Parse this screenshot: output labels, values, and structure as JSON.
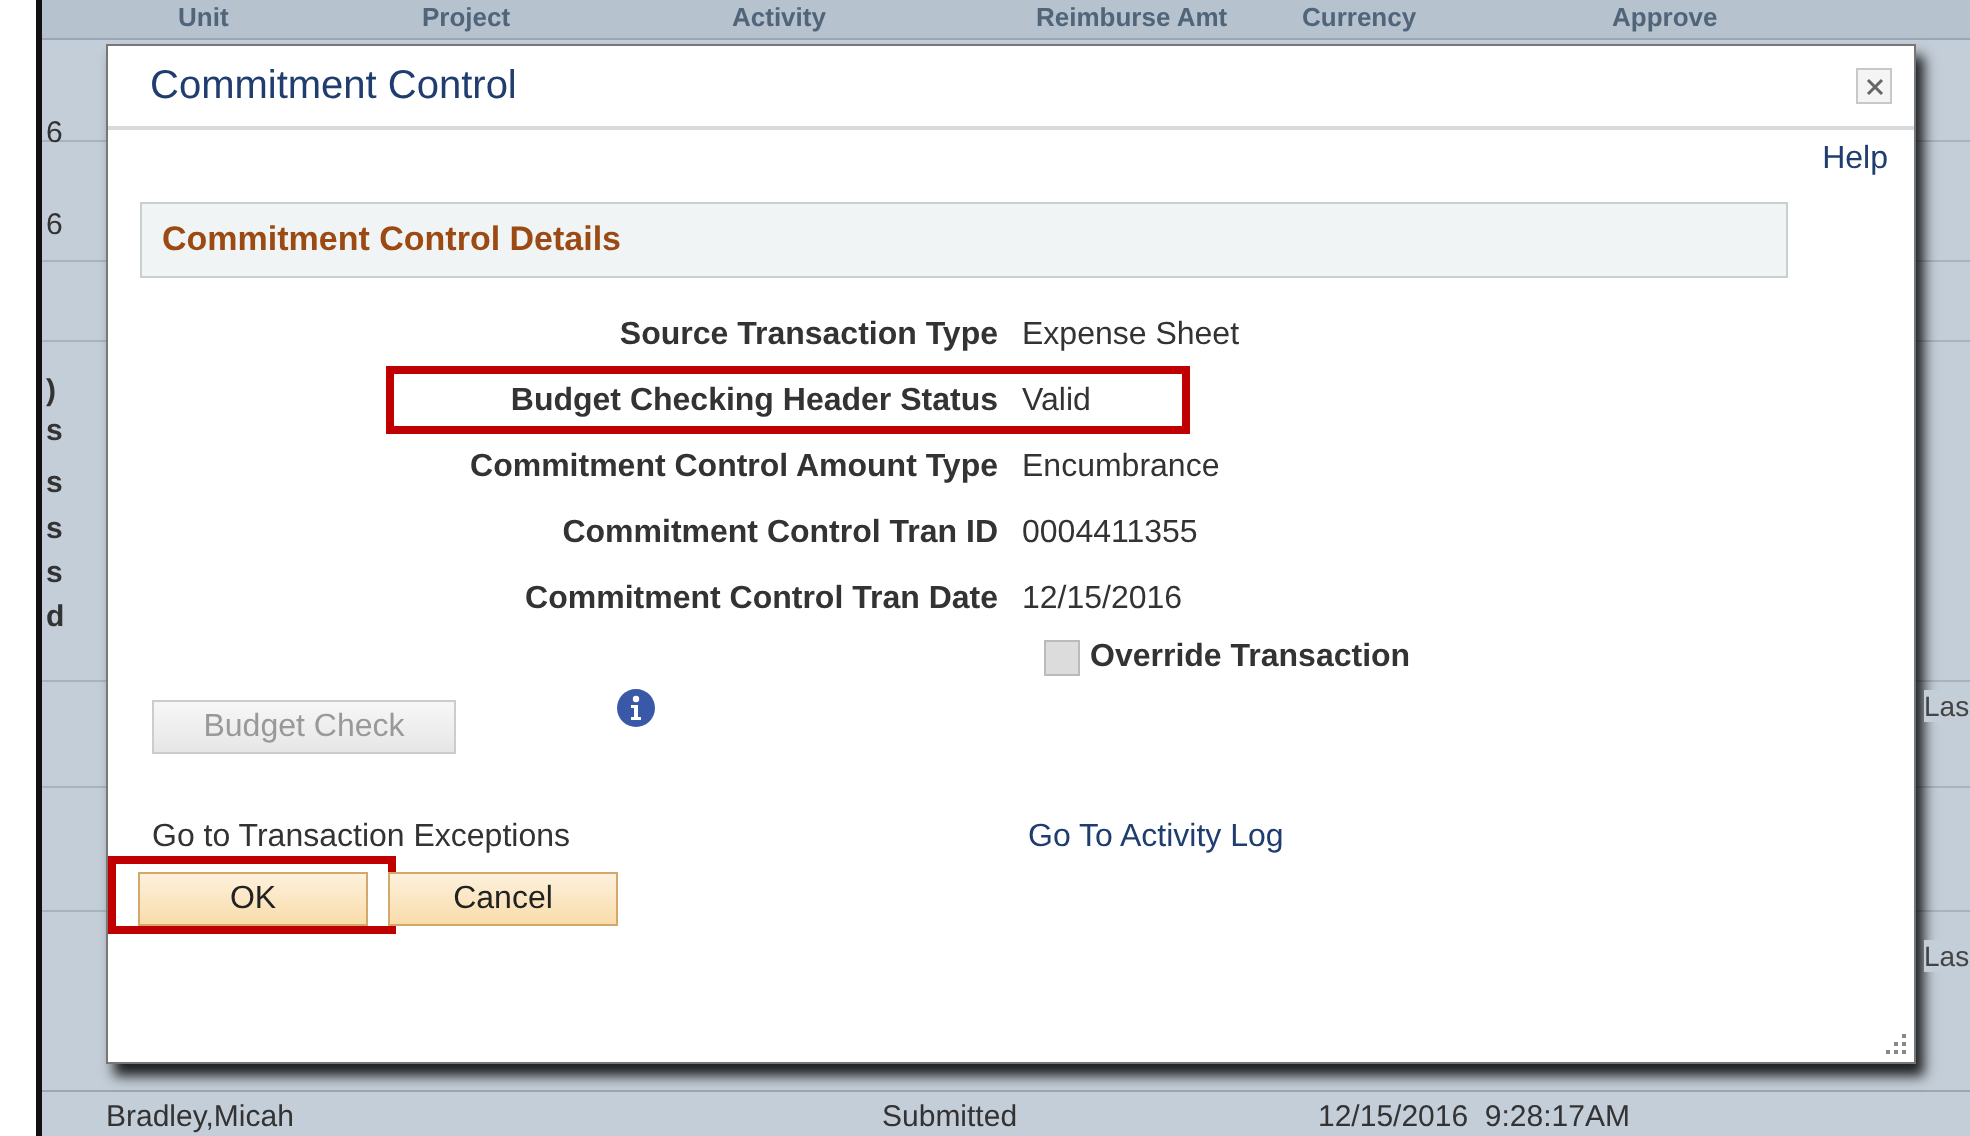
{
  "background": {
    "columns": [
      "Unit",
      "Project",
      "Activity",
      "Reimburse Amt",
      "Currency",
      "Approve"
    ],
    "left_fragments": [
      "6",
      "6",
      ")",
      "s",
      "s",
      "s",
      "s",
      "d"
    ],
    "right_fragments": [
      "Las",
      "Las"
    ],
    "bottom_row": [
      "Bradley,Micah",
      "Submitted",
      "12/15/2016  9:28:17AM"
    ]
  },
  "dialog": {
    "title": "Commitment Control",
    "help": "Help",
    "section_title": "Commitment Control Details",
    "fields": [
      {
        "label": "Source Transaction Type",
        "value": "Expense Sheet",
        "highlighted": false
      },
      {
        "label": "Budget Checking Header Status",
        "value": "Valid",
        "highlighted": true
      },
      {
        "label": "Commitment Control Amount Type",
        "value": "Encumbrance",
        "highlighted": false
      },
      {
        "label": "Commitment Control Tran ID",
        "value": "0004411355",
        "highlighted": false
      },
      {
        "label": "Commitment Control Tran Date",
        "value": "12/15/2016",
        "highlighted": false
      }
    ],
    "override": {
      "label": "Override Transaction",
      "checked": false,
      "disabled": true
    },
    "budget_check": {
      "label": "Budget Check",
      "disabled": true
    },
    "links": [
      "Go to Transaction Exceptions",
      "Go To Activity Log"
    ],
    "buttons": [
      {
        "label": "OK",
        "highlighted": true
      },
      {
        "label": "Cancel",
        "highlighted": false
      }
    ]
  }
}
